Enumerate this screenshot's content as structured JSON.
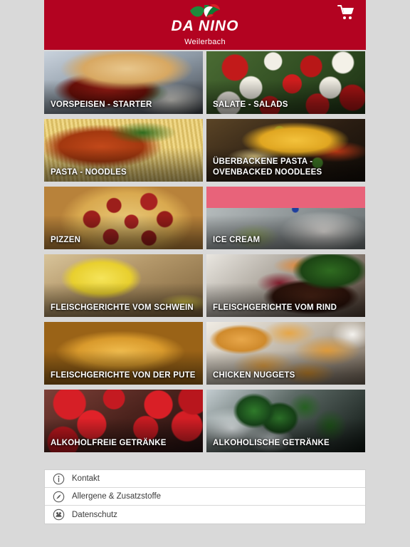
{
  "header": {
    "brand": "DA NINO",
    "city": "Weilerbach",
    "brand_color": "#b30321",
    "cart_icon": "shopping-cart-icon"
  },
  "menu": {
    "categories": [
      {
        "label": "VORSPEISEN - STARTER",
        "photo": "p-starter"
      },
      {
        "label": "SALATE - SALADS",
        "photo": "p-salad"
      },
      {
        "label": "PASTA - NOODLES",
        "photo": "p-pasta"
      },
      {
        "label": "ÜBERBACKENE PASTA - OVENBACKED NOODLEES",
        "photo": "p-oven"
      },
      {
        "label": "PIZZEN",
        "photo": "p-pizza"
      },
      {
        "label": "ICE CREAM",
        "photo": "p-ice"
      },
      {
        "label": "FLEISCHGERICHTE VOM SCHWEIN",
        "photo": "p-pork"
      },
      {
        "label": "FLEISCHGERICHTE VOM RIND",
        "photo": "p-beef"
      },
      {
        "label": "FLEISCHGERICHTE VON DER PUTE",
        "photo": "p-turkey"
      },
      {
        "label": "CHICKEN NUGGETS",
        "photo": "p-nuggets"
      },
      {
        "label": "ALKOHOLFREIE GETRÄNKE",
        "photo": "p-soft"
      },
      {
        "label": "ALKOHOLISCHE GETRÄNKE",
        "photo": "p-alc"
      }
    ]
  },
  "footer": {
    "items": [
      {
        "label": "Kontakt",
        "icon": "info-circle-icon"
      },
      {
        "label": "Allergene & Zusatzstoffe",
        "icon": "allergen-circle-icon"
      },
      {
        "label": "Datenschutz",
        "icon": "privacy-shield-circle-icon"
      }
    ]
  }
}
